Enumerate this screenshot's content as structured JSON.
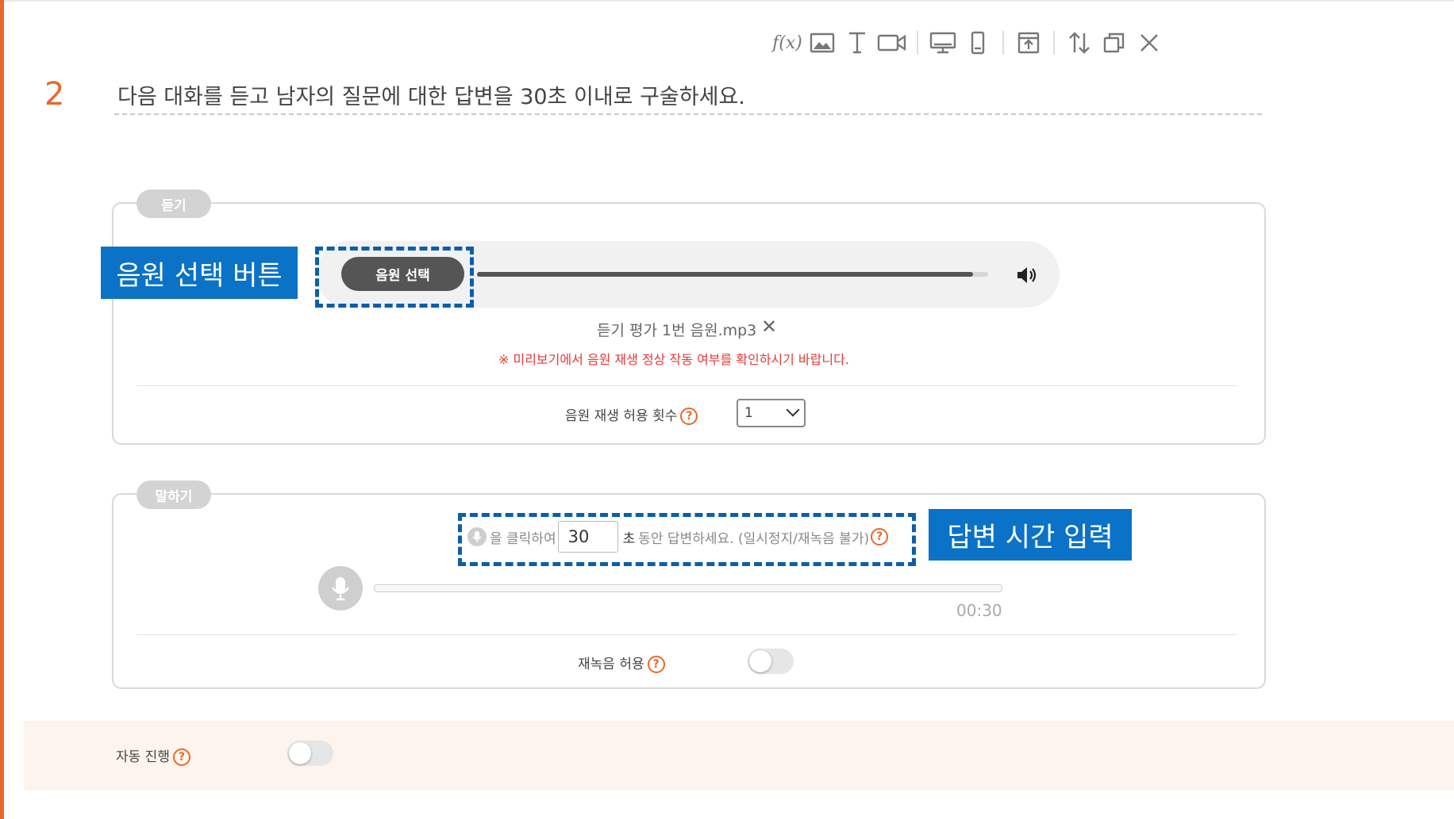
{
  "toolbar": {
    "icons": [
      "formula-icon",
      "image-icon",
      "text-icon",
      "video-icon",
      "desktop-view-icon",
      "mobile-view-icon",
      "preview-icon",
      "reorder-icon",
      "duplicate-icon",
      "close-icon"
    ],
    "formula_label": "f(x)"
  },
  "question": {
    "number": "2",
    "text": "다음 대화를 듣고 남자의 질문에 대한 답변을 30초 이내로 구술하세요."
  },
  "listening": {
    "tag": "듣기",
    "audio_button": "음원 선택",
    "progress": 0.97,
    "file_name": "듣기 평가 1번 음원.mp3",
    "file_remove": "✕",
    "notice": "※ 미리보기에서 음원 재생 정상 작동 여부를 확인하시기 바랍니다.",
    "play_limit_label": "음원 재생 허용 횟수",
    "play_limit_value": "1"
  },
  "speaking": {
    "tag": "말하기",
    "instr_before": "을 클릭하여",
    "seconds": "30",
    "unit": "초",
    "instr_after": "동안 답변하세요. (일시정지/재녹음 불가)",
    "time": "00:30",
    "rerecord_label": "재녹음 허용",
    "rerecord_enabled": false
  },
  "auto": {
    "label": "자동 진행",
    "enabled": false
  },
  "annotations": {
    "audio_select": "음원 선택 버튼",
    "answer_time": "답변 시간 입력"
  },
  "help_glyph": "?",
  "colors": {
    "accent": "#e8692b",
    "annotation": "#0a72c7",
    "notice": "#e53935",
    "auto_bg": "#fdf4ee"
  }
}
